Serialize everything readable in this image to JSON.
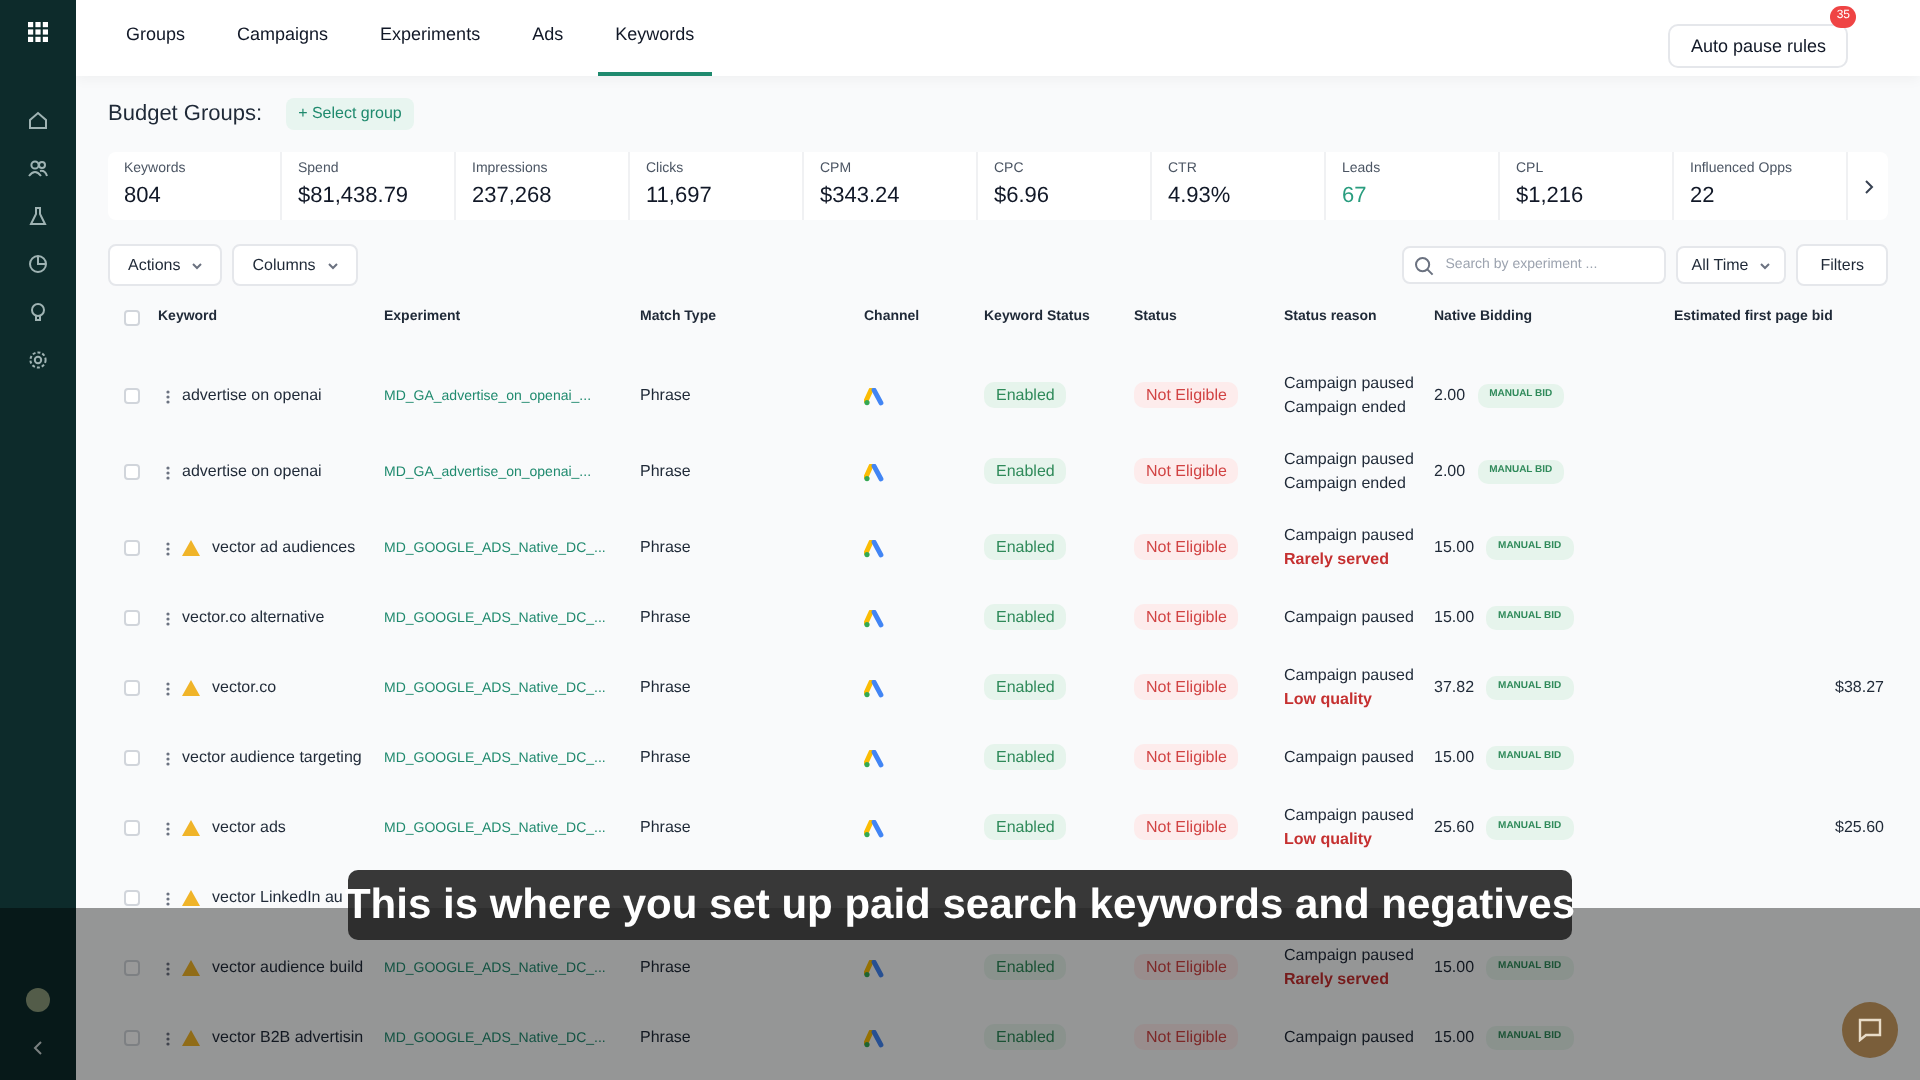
{
  "nav_tabs": [
    {
      "label": "Groups",
      "selected": false
    },
    {
      "label": "Campaigns",
      "selected": false
    },
    {
      "label": "Experiments",
      "selected": false
    },
    {
      "label": "Ads",
      "selected": false
    },
    {
      "label": "Keywords",
      "selected": true
    }
  ],
  "auto_pause": {
    "label": "Auto pause rules",
    "badge": "35"
  },
  "budget_groups": {
    "label": "Budget Groups:",
    "button": "+ Select group"
  },
  "metrics": [
    {
      "label": "Keywords",
      "value": "804",
      "accent": false
    },
    {
      "label": "Spend",
      "value": "$81,438.79",
      "accent": false
    },
    {
      "label": "Impressions",
      "value": "237,268",
      "accent": false
    },
    {
      "label": "Clicks",
      "value": "11,697",
      "accent": false
    },
    {
      "label": "CPM",
      "value": "$343.24",
      "accent": false
    },
    {
      "label": "CPC",
      "value": "$6.96",
      "accent": false
    },
    {
      "label": "CTR",
      "value": "4.93%",
      "accent": false
    },
    {
      "label": "Leads",
      "value": "67",
      "accent": true
    },
    {
      "label": "CPL",
      "value": "$1,216",
      "accent": false
    },
    {
      "label": "Influenced Opps",
      "value": "22",
      "accent": false
    }
  ],
  "toolbar": {
    "actions": "Actions",
    "columns": "Columns",
    "search_placeholder": "Search by experiment ...",
    "time": "All Time",
    "filters": "Filters"
  },
  "table": {
    "columns": [
      "Keyword",
      "Experiment",
      "Match Type",
      "Channel",
      "Keyword Status",
      "Status",
      "Status reason",
      "Native Bidding",
      "Estimated first page bid"
    ],
    "select_all_checked": false,
    "rows": [
      {
        "keyword": "advertise on openai",
        "warning": false,
        "checked": false,
        "experiment": "MD_GA_advertise_on_openai_...",
        "match_type": "Phrase",
        "keyword_status": "Enabled",
        "status": "Not Eligible",
        "reasons": [
          {
            "text": "Campaign paused",
            "kind": "normal"
          },
          {
            "text": "Campaign ended",
            "kind": "normal"
          }
        ],
        "bid": "2.00",
        "bid_type": "MANUAL BID"
      },
      {
        "keyword": "advertise on openai",
        "warning": false,
        "checked": false,
        "experiment": "MD_GA_advertise_on_openai_...",
        "match_type": "Phrase",
        "keyword_status": "Enabled",
        "status": "Not Eligible",
        "reasons": [
          {
            "text": "Campaign paused",
            "kind": "normal"
          },
          {
            "text": "Campaign ended",
            "kind": "normal"
          }
        ],
        "bid": "2.00",
        "bid_type": "MANUAL BID"
      },
      {
        "keyword": "vector ad audiences",
        "warning": true,
        "checked": false,
        "experiment": "MD_GOOGLE_ADS_Native_DC_...",
        "match_type": "Phrase",
        "keyword_status": "Enabled",
        "status": "Not Eligible",
        "reasons": [
          {
            "text": "Campaign paused",
            "kind": "normal"
          },
          {
            "text": "Rarely served",
            "kind": "alert"
          }
        ],
        "bid": "15.00",
        "bid_type": "MANUAL BID"
      },
      {
        "keyword": "vector.co alternative",
        "warning": false,
        "checked": false,
        "experiment": "MD_GOOGLE_ADS_Native_DC_...",
        "match_type": "Phrase",
        "keyword_status": "Enabled",
        "status": "Not Eligible",
        "reasons": [
          {
            "text": "Campaign paused",
            "kind": "normal"
          }
        ],
        "bid": "15.00",
        "bid_type": "MANUAL BID"
      },
      {
        "keyword": "vector.co",
        "warning": true,
        "checked": false,
        "experiment": "MD_GOOGLE_ADS_Native_DC_...",
        "match_type": "Phrase",
        "keyword_status": "Enabled",
        "status": "Not Eligible",
        "reasons": [
          {
            "text": "Campaign paused",
            "kind": "normal"
          },
          {
            "text": "Low quality",
            "kind": "alert"
          }
        ],
        "bid": "37.82",
        "bid_type": "MANUAL BID",
        "est_bid": "$38.27"
      },
      {
        "keyword": "vector audience targeting",
        "warning": false,
        "checked": false,
        "experiment": "MD_GOOGLE_ADS_Native_DC_...",
        "match_type": "Phrase",
        "keyword_status": "Enabled",
        "status": "Not Eligible",
        "reasons": [
          {
            "text": "Campaign paused",
            "kind": "normal"
          }
        ],
        "bid": "15.00",
        "bid_type": "MANUAL BID"
      },
      {
        "keyword": "vector ads",
        "warning": true,
        "checked": false,
        "experiment": "MD_GOOGLE_ADS_Native_DC_...",
        "match_type": "Phrase",
        "keyword_status": "Enabled",
        "status": "Not Eligible",
        "reasons": [
          {
            "text": "Campaign paused",
            "kind": "normal"
          },
          {
            "text": "Low quality",
            "kind": "alert"
          }
        ],
        "bid": "25.60",
        "bid_type": "MANUAL BID",
        "est_bid": "$25.60"
      },
      {
        "keyword": "vector LinkedIn au",
        "warning": true,
        "checked": false
      },
      {
        "keyword": "vector audience build",
        "warning": true,
        "checked": false,
        "experiment": "MD_GOOGLE_ADS_Native_DC_...",
        "match_type": "Phrase",
        "keyword_status": "Enabled",
        "status": "Not Eligible",
        "reasons": [
          {
            "text": "Campaign paused",
            "kind": "normal"
          },
          {
            "text": "Rarely served",
            "kind": "alert"
          }
        ],
        "bid": "15.00",
        "bid_type": "MANUAL BID"
      },
      {
        "keyword": "vector B2B advertisin",
        "warning": true,
        "checked": false,
        "experiment": "MD_GOOGLE_ADS_Native_DC_...",
        "match_type": "Phrase",
        "keyword_status": "Enabled",
        "status": "Not Eligible",
        "reasons": [
          {
            "text": "Campaign paused",
            "kind": "normal"
          }
        ],
        "bid": "15.00",
        "bid_type": "MANUAL BID"
      }
    ]
  },
  "caption": "This is where you set up paid search keywords and negatives"
}
